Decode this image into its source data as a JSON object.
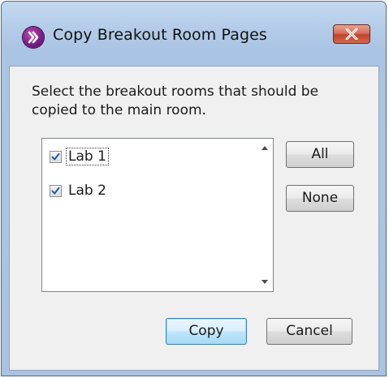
{
  "window": {
    "title": "Copy Breakout Room Pages",
    "icon": "app-logo-icon",
    "close_icon": "close-icon"
  },
  "dialog": {
    "instructions": "Select the breakout rooms that should be copied to the main room.",
    "rooms": [
      {
        "label": "Lab 1",
        "checked": true
      },
      {
        "label": "Lab 2",
        "checked": true
      }
    ],
    "buttons": {
      "all": "All",
      "none": "None",
      "copy": "Copy",
      "cancel": "Cancel"
    }
  },
  "colors": {
    "titlebar": "#b5cde9",
    "close_button": "#c0442a",
    "default_button_border": "#3c7fb1",
    "checkmark": "#1d5aa8"
  }
}
